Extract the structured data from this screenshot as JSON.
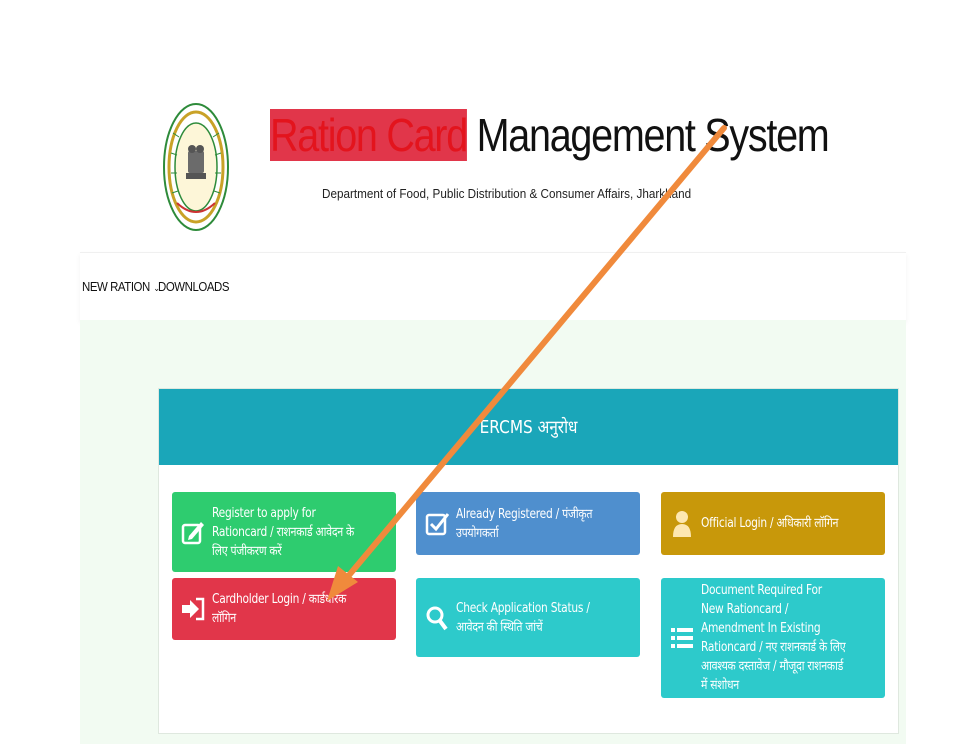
{
  "header": {
    "title_part1": "Ration Card",
    "title_part2": "Management System",
    "subtitle": "Department of Food, Public Distribution & Consumer Affairs, Jharkhand"
  },
  "nav": {
    "items": [
      {
        "label": "NEW RATION",
        "has_dropdown": true
      },
      {
        "label": "DOWNLOADS",
        "has_dropdown": false
      }
    ]
  },
  "panel": {
    "title": "ERCMS अनुरोध"
  },
  "buttons": {
    "register": {
      "label": "Register to apply for Rationcard / राशनकार्ड आवेदन के लिए पंजीकरण करें",
      "icon": "edit-icon",
      "color": "#2ecc6f"
    },
    "already_registered": {
      "label": "Already Registered / पंजीकृत उपयोगकर्ता",
      "icon": "checkbox-icon",
      "color": "#4f8fce"
    },
    "official_login": {
      "label": "Official Login / अधिकारी लॉगिन",
      "icon": "user-icon",
      "color": "#c8980a"
    },
    "cardholder_login": {
      "label": "Cardholder Login / कार्डधारक लॉगिन",
      "icon": "sign-in-icon",
      "color": "#e1364a"
    },
    "check_status": {
      "label": "Check Application Status / आवेदन की स्थिति जांचें",
      "icon": "search-icon",
      "color": "#2dcacb"
    },
    "documents": {
      "label": "Document Required For New Rationcard / Amendment In Existing Rationcard / नए राशनकार्ड के लिए आवश्यक दस्तावेज / मौजूदा राशनकार्ड में संशोधन",
      "icon": "list-icon",
      "color": "#2dcacb"
    }
  },
  "annotation": {
    "arrow_color": "#f08a3c"
  }
}
